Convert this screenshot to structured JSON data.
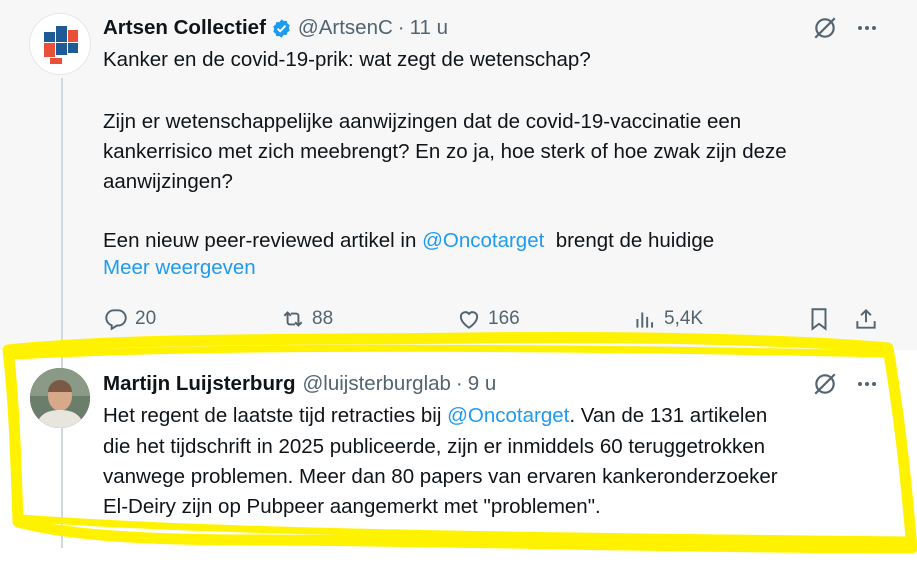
{
  "tweet1": {
    "name": "Artsen Collectief",
    "handle": "@ArtsenC",
    "sep": "·",
    "time": "11 u",
    "line1": "Kanker en de covid-19-prik: wat zegt de wetenschap?",
    "line2": "Zijn er wetenschappelijke aanwijzingen dat de covid-19-vaccinatie een",
    "line3": "kankerrisico met zich meebrengt? En zo ja, hoe sterk of hoe zwak zijn deze",
    "line4": "aanwijzingen?",
    "line5a": "Een nieuw peer-reviewed artikel in ",
    "line5_mention": "@Oncotarget",
    "line5b": "  brengt de huidige",
    "show_more": "Meer weergeven",
    "replies": "20",
    "reposts": "88",
    "likes": "166",
    "views": "5,4K"
  },
  "tweet2": {
    "name": "Martijn Luijsterburg",
    "handle": "@luijsterburglab",
    "sep": "·",
    "time": "9 u",
    "line1a": "Het regent de laatste tijd retracties bij ",
    "line1_mention": "@Oncotarget",
    "line1b": ". Van de 131 artikelen",
    "line2": "die het tijdschrift in 2025 publiceerde, zijn er inmiddels 60 teruggetrokken",
    "line3": "vanwege problemen. Meer dan 80 papers van ervaren kankeronderzoeker",
    "line4": "El-Deiry zijn op Pubpeer aangemerkt met \"problemen\"."
  },
  "icons": {
    "verified": "verified-badge-icon",
    "grok": "grok-icon",
    "more": "more-icon",
    "reply": "reply-icon",
    "repost": "repost-icon",
    "like": "like-icon",
    "views": "views-icon",
    "bookmark": "bookmark-icon",
    "share": "share-icon"
  },
  "colors": {
    "accent": "#1d9bf0",
    "highlight": "#fff200",
    "top_background": "#f7f7f7"
  }
}
